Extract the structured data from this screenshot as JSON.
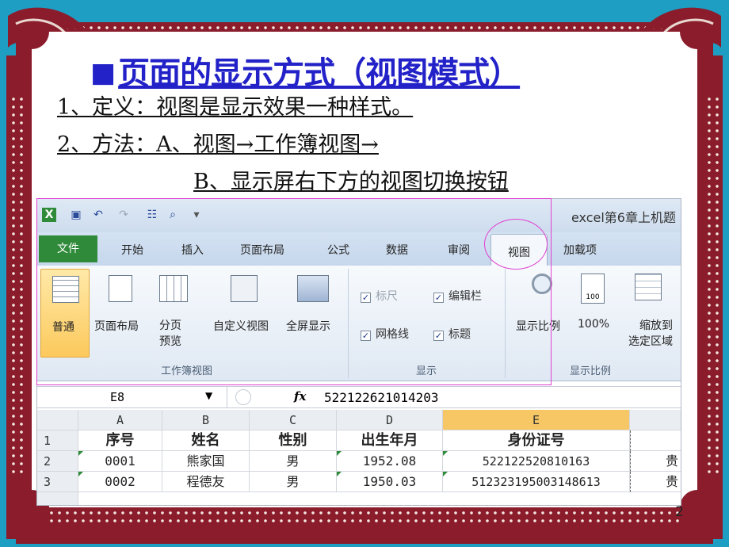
{
  "title": "页面的显示方式（视图模式）",
  "lines": [
    "1、定义：视图是显示效果一种样式。",
    "2、方法：A、视图→工作簿视图→",
    "B、显示屏右下方的视图切换按钮"
  ],
  "page_number": "2",
  "excel": {
    "window_title": "excel第6章上机题",
    "tabs": [
      "文件",
      "开始",
      "插入",
      "页面布局",
      "公式",
      "数据",
      "审阅",
      "视图",
      "加载项"
    ],
    "ribbon": {
      "workbook_views": {
        "group_label": "工作簿视图",
        "buttons": [
          "普通",
          "页面布局",
          "分页\n预览",
          "自定义视图",
          "全屏显示"
        ]
      },
      "show": {
        "group_label": "显示",
        "checkboxes": [
          {
            "label": "标尺",
            "checked": true,
            "enabled": false
          },
          {
            "label": "编辑栏",
            "checked": true,
            "enabled": true
          },
          {
            "label": "网格线",
            "checked": true,
            "enabled": true
          },
          {
            "label": "标题",
            "checked": true,
            "enabled": true
          }
        ]
      },
      "zoom": {
        "group_label": "显示比例",
        "buttons": [
          "显示比例",
          "100%",
          "缩放到\n选定区域"
        ]
      }
    },
    "formula_bar": {
      "name_box": "E8",
      "fx": "fx",
      "value": "522122621014203"
    },
    "columns": [
      "A",
      "B",
      "C",
      "D",
      "E"
    ],
    "row_numbers": [
      "1",
      "2",
      "3"
    ],
    "header_row": [
      "序号",
      "姓名",
      "性别",
      "出生年月",
      "身份证号"
    ],
    "rows": [
      [
        "0001",
        "熊家国",
        "男",
        "1952.08",
        "522122520810163",
        "贵"
      ],
      [
        "0002",
        "程德友",
        "男",
        "1950.03",
        "512323195003148613",
        "贵"
      ]
    ],
    "colors": {
      "file_tab": "#2f8a3a",
      "highlight": "#e040d0",
      "selected_col": "#f7c766"
    }
  },
  "colors": {
    "title": "#2222c8",
    "frame": "#8b1c2c",
    "background": "#1d9ec2"
  }
}
